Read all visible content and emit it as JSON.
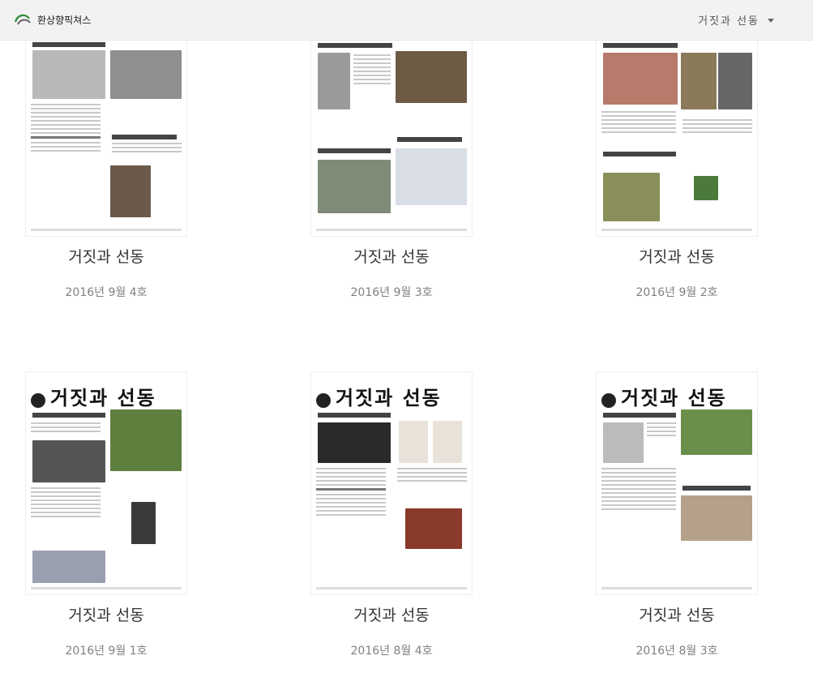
{
  "header": {
    "brand_name": "환상향픽쳐스",
    "filter_label": "거짓과 선동"
  },
  "colors": {
    "topbar_bg": "#f2f2f2",
    "title_text": "#333333",
    "date_text": "#808080",
    "accent_green": "#2f8a3a"
  },
  "cards": [
    {
      "title": "거짓과 선동",
      "date": "2016년 9월 4호"
    },
    {
      "title": "거짓과 선동",
      "date": "2016년 9월 3호"
    },
    {
      "title": "거짓과 선동",
      "date": "2016년 9월 2호"
    },
    {
      "title": "거짓과 선동",
      "date": "2016년 9월 1호"
    },
    {
      "title": "거짓과 선동",
      "date": "2016년 8월 4호"
    },
    {
      "title": "거짓과 선동",
      "date": "2016년 8월 3호"
    }
  ],
  "mastheads": {
    "card3": "거짓과 선동",
    "card4": "거짓과 선동",
    "card5": "거짓과 선동"
  }
}
